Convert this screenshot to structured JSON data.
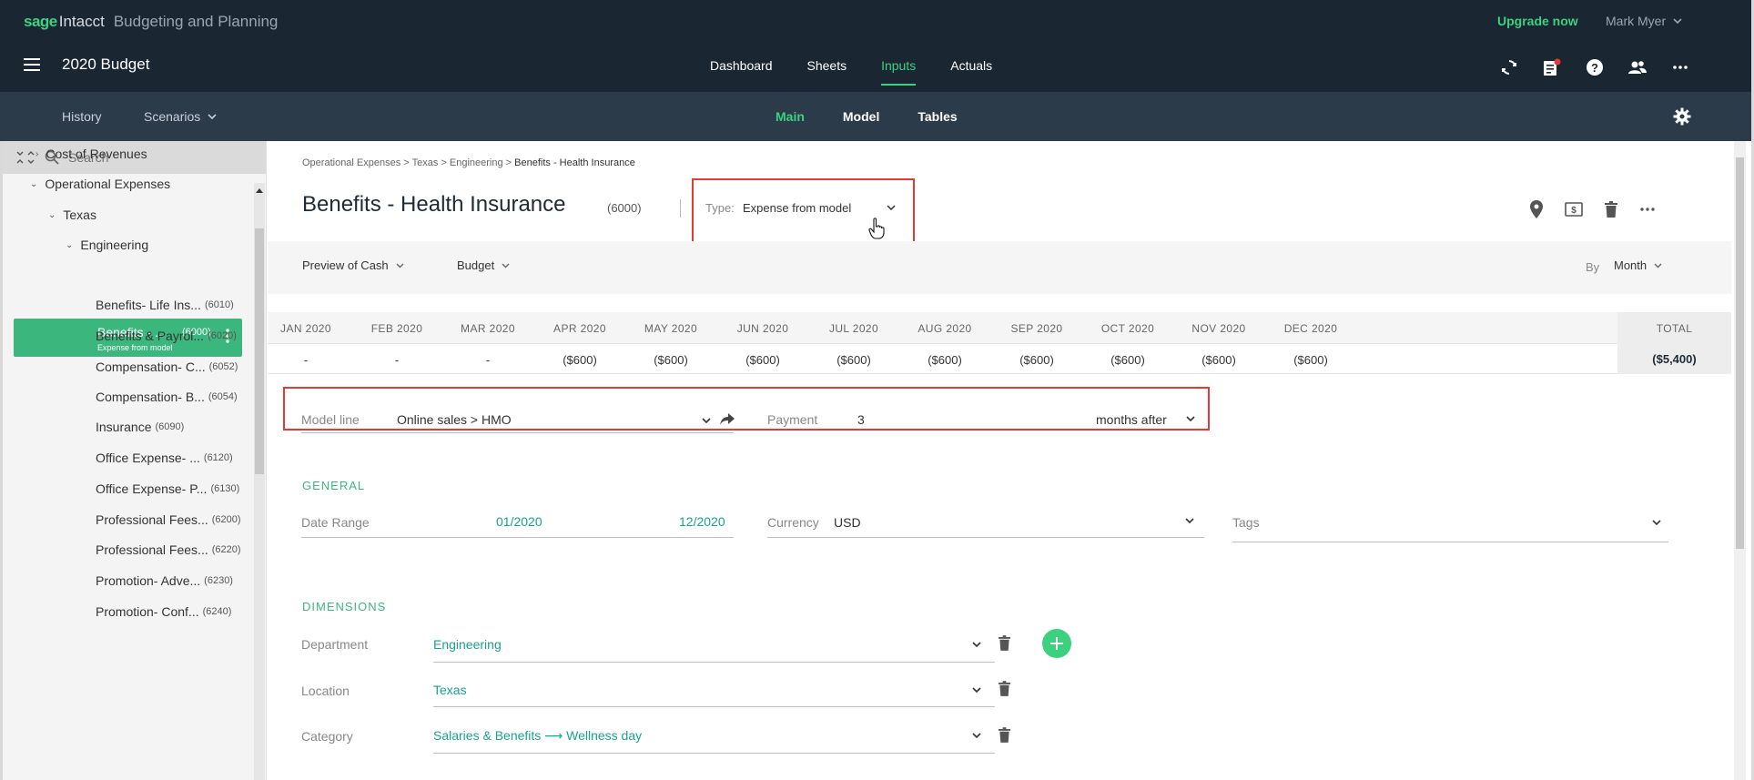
{
  "brand": {
    "sage": "sage",
    "intacct": "Intacct",
    "product": "Budgeting and Planning",
    "accent": "#3bd17f"
  },
  "header": {
    "upgrade": "Upgrade now",
    "user": "Mark Myer",
    "budget": "2020 Budget",
    "nav": [
      "Dashboard",
      "Sheets",
      "Inputs",
      "Actuals"
    ],
    "active_nav": "Inputs",
    "icons": [
      "sync-icon",
      "notifications-icon",
      "help-icon",
      "users-icon",
      "more-icon"
    ]
  },
  "subheader": {
    "history": "History",
    "scenarios": "Scenarios",
    "tabs": [
      "Main",
      "Model",
      "Tables"
    ],
    "active_tab": "Main"
  },
  "sidebar": {
    "search_placeholder": "Search",
    "items": [
      {
        "label": "Cost of Revenues",
        "code": ""
      },
      {
        "label": "Operational Expenses",
        "code": ""
      },
      {
        "label": "Texas",
        "code": ""
      },
      {
        "label": "Engineering",
        "code": ""
      },
      {
        "label": "Benefits - ...",
        "code": "(6000)",
        "sub": "Expense from model"
      },
      {
        "label": "Benefits- Life Ins...",
        "code": "(6010)"
      },
      {
        "label": "Benefits & Payrol...",
        "code": "(6020)"
      },
      {
        "label": "Compensation- C...",
        "code": "(6052)"
      },
      {
        "label": "Compensation- B...",
        "code": "(6054)"
      },
      {
        "label": "Insurance",
        "code": "(6090)"
      },
      {
        "label": "Office Expense- ...",
        "code": "(6120)"
      },
      {
        "label": "Office Expense- P...",
        "code": "(6130)"
      },
      {
        "label": "Professional Fees...",
        "code": "(6200)"
      },
      {
        "label": "Professional Fees...",
        "code": "(6220)"
      },
      {
        "label": "Promotion- Adve...",
        "code": "(6230)"
      },
      {
        "label": "Promotion- Conf...",
        "code": "(6240)"
      }
    ]
  },
  "breadcrumb": {
    "parts": [
      "Operational Expenses",
      "Texas",
      "Engineering"
    ],
    "current": "Benefits - Health Insurance",
    "sep": " > "
  },
  "account": {
    "title": "Benefits - Health Insurance",
    "code": "(6000)",
    "type_label": "Type:",
    "type_value": "Expense from model"
  },
  "filters": {
    "view": "Preview of Cash",
    "scenario": "Budget",
    "by_label": "By",
    "by_value": "Month"
  },
  "months": [
    "JAN 2020",
    "FEB 2020",
    "MAR 2020",
    "APR 2020",
    "MAY 2020",
    "JUN 2020",
    "JUL 2020",
    "AUG 2020",
    "SEP 2020",
    "OCT 2020",
    "NOV 2020",
    "DEC 2020"
  ],
  "values": [
    "-",
    "-",
    "-",
    "($600)",
    "($600)",
    "($600)",
    "($600)",
    "($600)",
    "($600)",
    "($600)",
    "($600)",
    "($600)"
  ],
  "total": {
    "label": "TOTAL",
    "value": "($5,400)"
  },
  "model": {
    "model_line_label": "Model line",
    "model_line_value": "Online sales > HMO",
    "payment_label": "Payment",
    "payment_value": "3",
    "payment_unit": "months after"
  },
  "general": {
    "heading": "GENERAL",
    "date_range_label": "Date Range",
    "start": "01/2020",
    "end": "12/2020",
    "currency_label": "Currency",
    "currency_value": "USD",
    "tags_label": "Tags"
  },
  "dimensions": {
    "heading": "DIMENSIONS",
    "rows": [
      {
        "label": "Department",
        "value": "Engineering"
      },
      {
        "label": "Location",
        "value": "Texas"
      },
      {
        "label": "Category",
        "value": "Salaries & Benefits ⟶ Wellness day"
      }
    ]
  }
}
